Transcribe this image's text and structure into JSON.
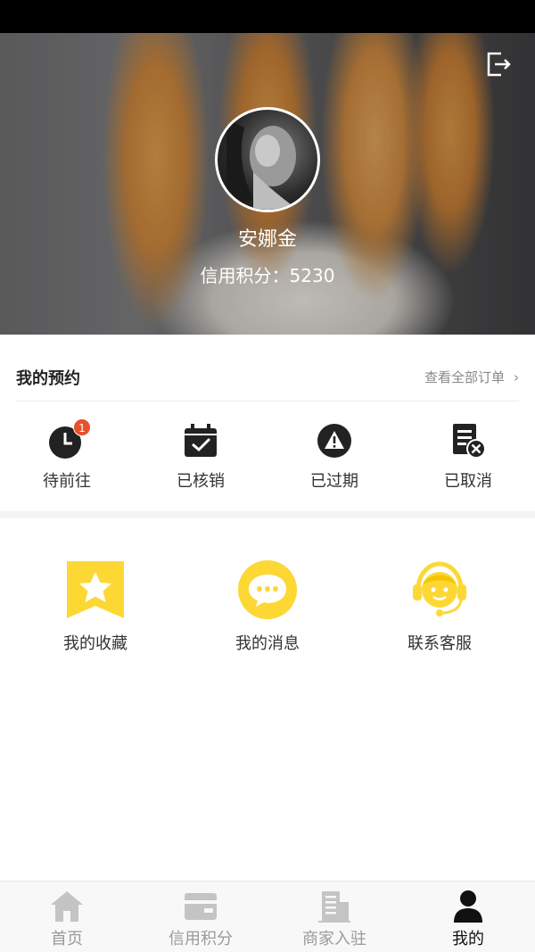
{
  "profile": {
    "name": "安娜金",
    "credit_label": "信用积分：",
    "credit_value": "5230"
  },
  "reservations": {
    "title": "我的预约",
    "view_all": "查看全部订单",
    "items": [
      {
        "label": "待前往",
        "icon": "clock-icon",
        "badge": "1"
      },
      {
        "label": "已核销",
        "icon": "calendar-check-icon"
      },
      {
        "label": "已过期",
        "icon": "warning-icon"
      },
      {
        "label": "已取消",
        "icon": "document-cancel-icon"
      }
    ]
  },
  "services": [
    {
      "label": "我的收藏",
      "icon": "star-bookmark-icon"
    },
    {
      "label": "我的消息",
      "icon": "chat-bubble-icon"
    },
    {
      "label": "联系客服",
      "icon": "customer-service-icon"
    }
  ],
  "tabbar": [
    {
      "label": "首页",
      "icon": "home-icon"
    },
    {
      "label": "信用积分",
      "icon": "wallet-icon"
    },
    {
      "label": "商家入驻",
      "icon": "building-icon"
    },
    {
      "label": "我的",
      "icon": "person-icon",
      "active": true
    }
  ],
  "colors": {
    "accent": "#fdd835",
    "badge": "#e94f2a",
    "text_dark": "#222222",
    "text_muted": "#9a9a9a"
  }
}
